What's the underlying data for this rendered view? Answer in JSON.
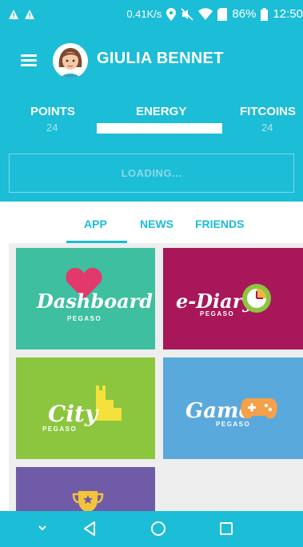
{
  "status_bar": {
    "left_icons": [
      "warning-icon",
      "warning-icon"
    ],
    "speed": "0.41K/s",
    "battery": "86%",
    "time": "12:50"
  },
  "header": {
    "user_name": "GIULIA BENNET",
    "points_label": "POINTS",
    "points_value": "24",
    "energy_label": "ENERGY",
    "energy_level": 1.0,
    "fitcoins_label": "FITCOINS",
    "fitcoins_value": "24",
    "loading_text": "LOADING..."
  },
  "tabs": [
    {
      "label": "APP",
      "active": true
    },
    {
      "label": "NEWS",
      "active": false
    },
    {
      "label": "FRIENDS",
      "active": false
    }
  ],
  "tiles": [
    {
      "title": "Dashboard",
      "subtitle": "PEGASO",
      "color": "#3dbfa0",
      "icon": "heart-icon"
    },
    {
      "title": "e-Diary",
      "subtitle": "PEGASO",
      "color": "#a8175a",
      "icon": "clock-icon"
    },
    {
      "title": "City",
      "subtitle": "PEGASO",
      "color": "#8cc63f",
      "icon": "building-icon"
    },
    {
      "title": "Game",
      "subtitle": "PEGASO",
      "color": "#5aa9dc",
      "icon": "gamepad-icon"
    },
    {
      "title": "",
      "subtitle": "",
      "color": "#6f5ba7",
      "icon": "trophy-icon"
    }
  ],
  "colors": {
    "primary": "#1cbdd6",
    "loading_text": "#8ad9e7",
    "grid_background": "#eeeeee"
  },
  "nav_bar": {
    "icons": [
      "chevron-down-icon",
      "back-icon",
      "home-icon",
      "recents-icon"
    ]
  }
}
